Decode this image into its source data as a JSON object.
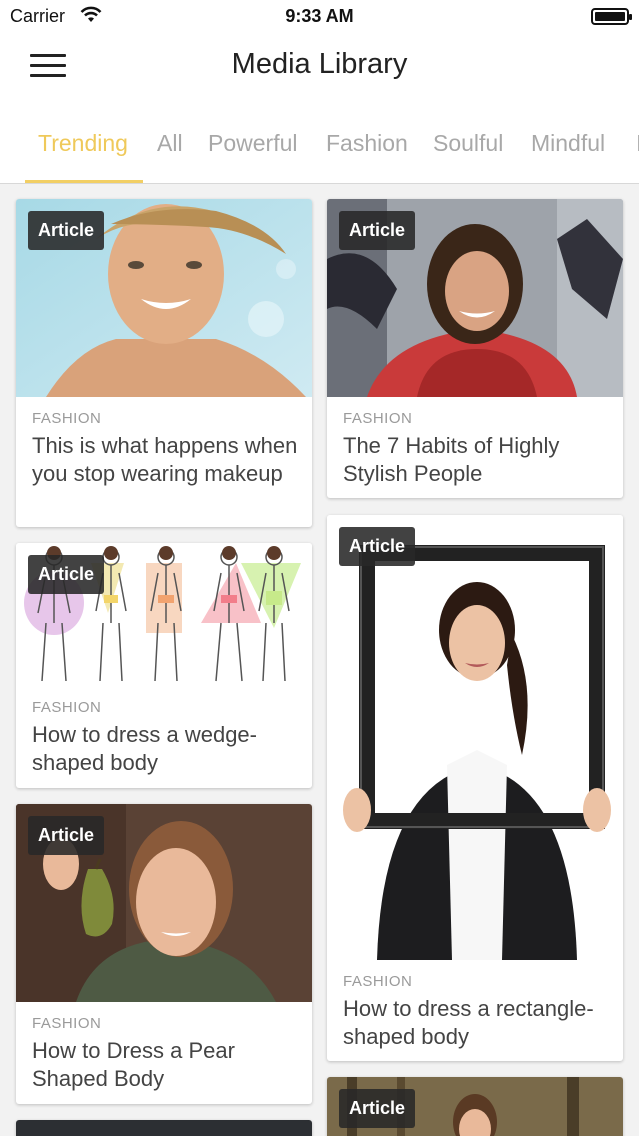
{
  "status_bar": {
    "carrier": "Carrier",
    "time": "9:33 AM"
  },
  "header": {
    "title": "Media Library"
  },
  "tabs": [
    {
      "label": "Trending",
      "active": true
    },
    {
      "label": "All"
    },
    {
      "label": "Powerful"
    },
    {
      "label": "Fashion"
    },
    {
      "label": "Soulful"
    },
    {
      "label": "Mindful"
    },
    {
      "label": "I"
    }
  ],
  "colors": {
    "accent": "#efc95a",
    "underline": "#f2cf64"
  },
  "cards": [
    {
      "badge": "Article",
      "category": "FASHION",
      "title": "This is what happens when you stop wearing makeup"
    },
    {
      "badge": "Article",
      "category": "FASHION",
      "title": "The 7 Habits of Highly Stylish People"
    },
    {
      "badge": "Article",
      "category": "FASHION",
      "title": "How to dress a wedge-shaped body"
    },
    {
      "badge": "Article",
      "category": "FASHION",
      "title": "How to dress a rectangle-shaped body"
    },
    {
      "badge": "Article",
      "category": "FASHION",
      "title": "How to Dress a Pear Shaped Body"
    },
    {
      "badge": "Article"
    }
  ]
}
